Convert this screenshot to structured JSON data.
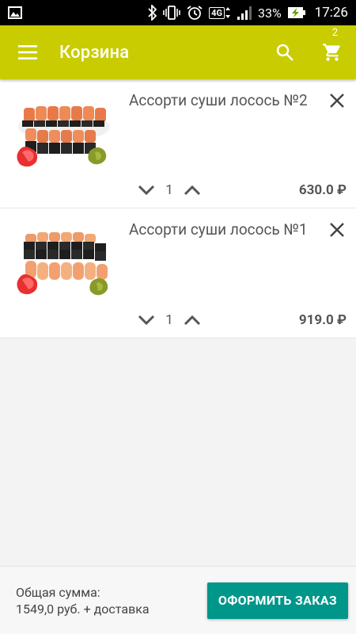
{
  "status_bar": {
    "network": "4G",
    "battery": "33%",
    "time": "17:26",
    "icons": [
      "image-icon",
      "bluetooth-icon",
      "vibrate-icon",
      "alarm-icon",
      "signal-icon",
      "battery-charging-icon"
    ]
  },
  "app_bar": {
    "title": "Корзина",
    "cart_count": "2",
    "color": "#c8cc00"
  },
  "cart": {
    "items": [
      {
        "name": "Ассорти суши лосось №2",
        "quantity": "1",
        "price": "630.0 ₽"
      },
      {
        "name": "Ассорти суши лосось №1",
        "quantity": "1",
        "price": "919.0 ₽"
      }
    ]
  },
  "footer": {
    "total_label": "Общая сумма:",
    "total_value": "1549,0 руб. + доставка",
    "checkout_label": "ОФОРМИТЬ ЗАКАЗ",
    "checkout_color": "#00968a"
  }
}
